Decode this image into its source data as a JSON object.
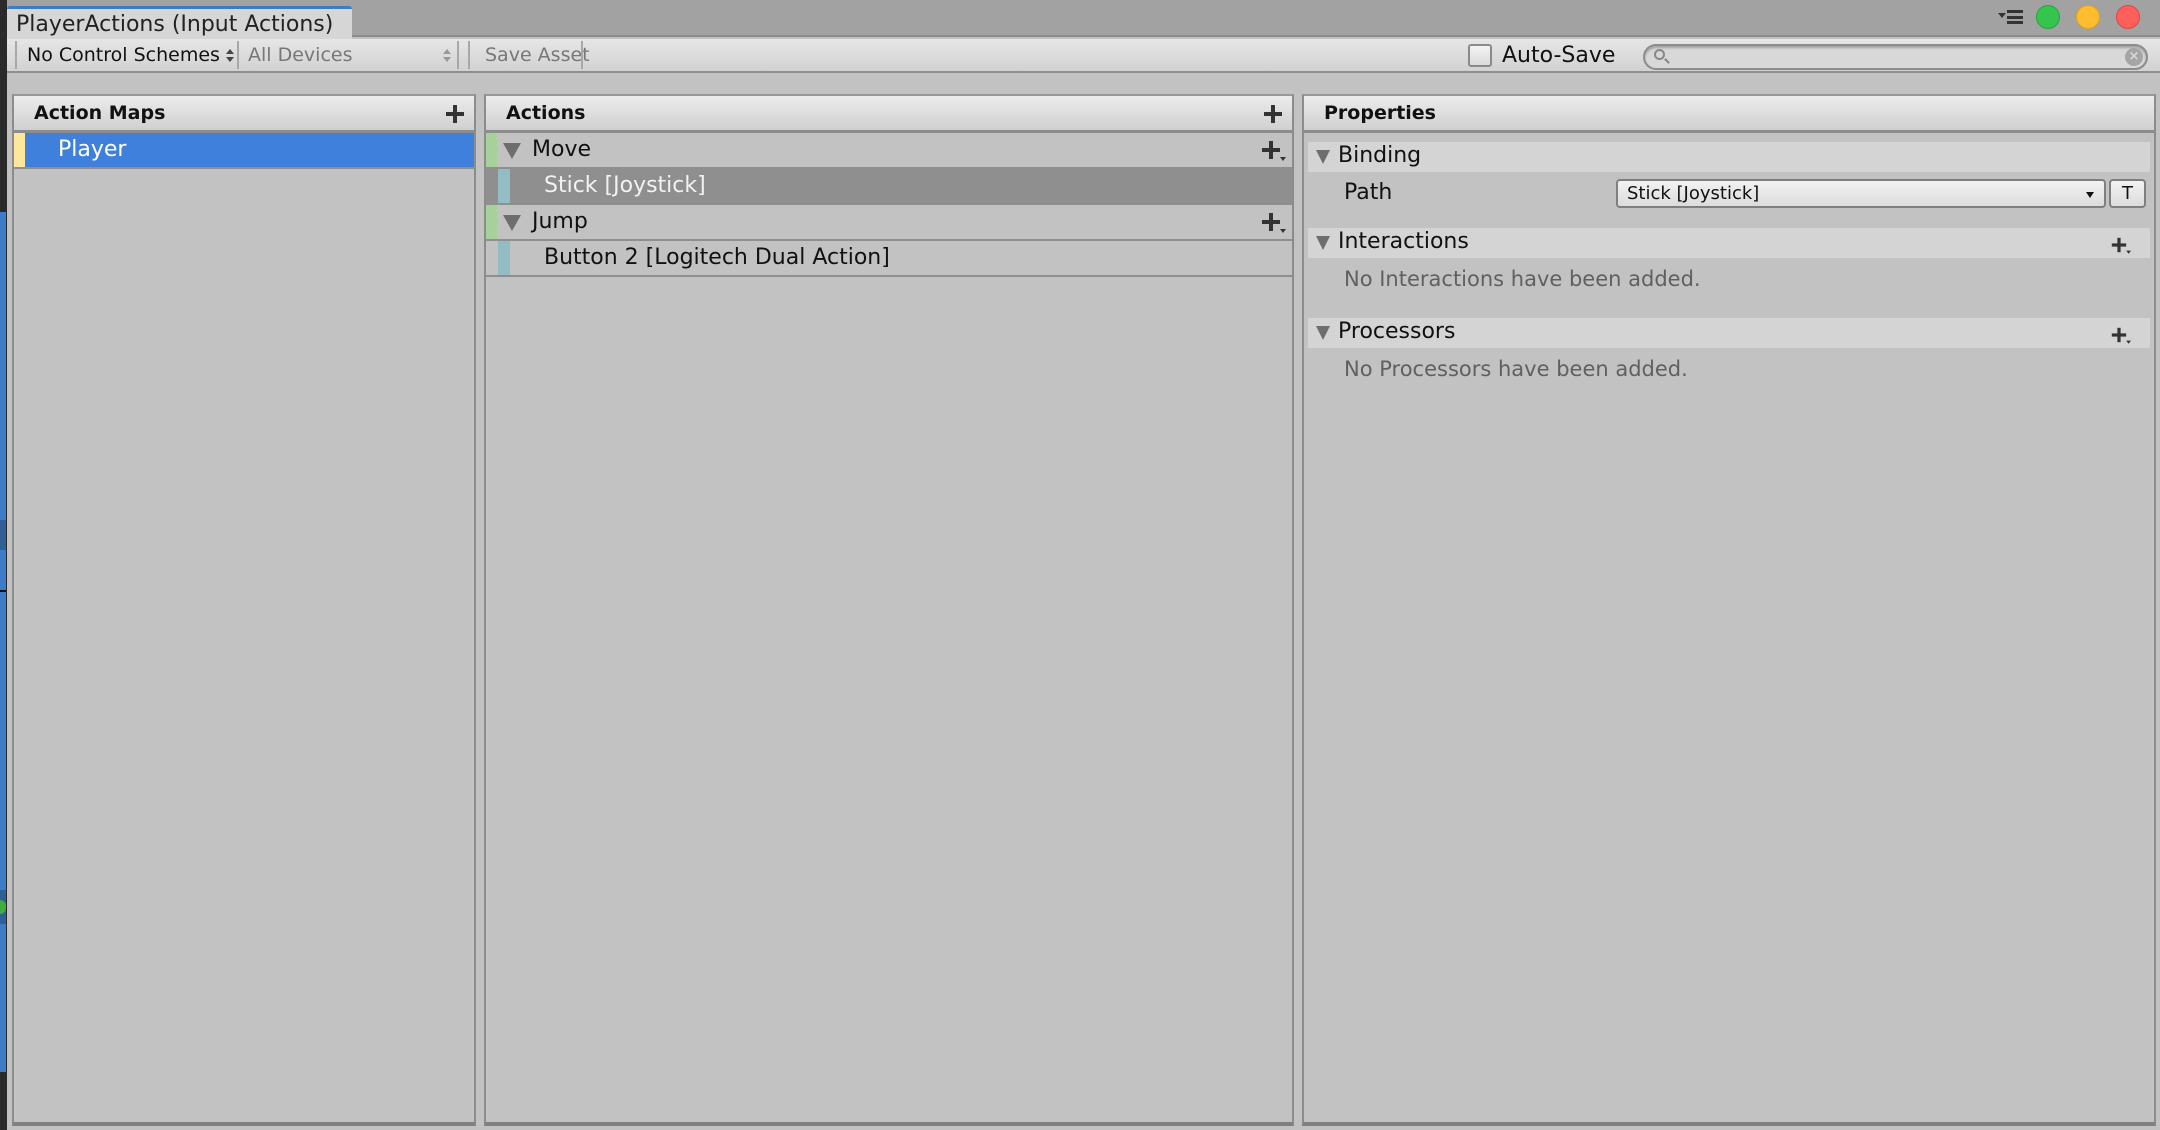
{
  "window": {
    "tab_title": "PlayerActions (Input Actions)",
    "icons": [
      "window-menu-icon",
      "zoom-light-icon",
      "minimize-light-icon",
      "close-light-icon"
    ]
  },
  "toolbar": {
    "control_scheme": "No Control Schemes",
    "devices": "All Devices",
    "save_asset": "Save Asset",
    "auto_save_label": "Auto-Save",
    "auto_save_checked": false,
    "search_value": "",
    "search_placeholder": ""
  },
  "action_maps": {
    "title": "Action Maps",
    "items": [
      {
        "label": "Player",
        "selected": true
      }
    ]
  },
  "actions": {
    "title": "Actions",
    "items": [
      {
        "type": "action",
        "label": "Move",
        "expanded": true
      },
      {
        "type": "binding",
        "label": "Stick [Joystick]",
        "selected": true
      },
      {
        "type": "action",
        "label": "Jump",
        "expanded": true
      },
      {
        "type": "binding",
        "label": "Button 2 [Logitech Dual Action]",
        "selected": false
      }
    ]
  },
  "properties": {
    "title": "Properties",
    "binding": {
      "header": "Binding",
      "path_label": "Path",
      "path_value": "Stick [Joystick]",
      "text_mode_button": "T"
    },
    "interactions": {
      "header": "Interactions",
      "empty_text": "No Interactions have been added."
    },
    "processors": {
      "header": "Processors",
      "empty_text": "No Processors have been added."
    }
  },
  "colors": {
    "selection_blue": "#3f80dc",
    "action_map_stripe": "#fde79a",
    "action_stripe": "#a6d19a",
    "binding_stripe": "#93bcc4",
    "selected_binding_bg": "#8f8f8f",
    "tab_accent": "#3d7cc9"
  }
}
